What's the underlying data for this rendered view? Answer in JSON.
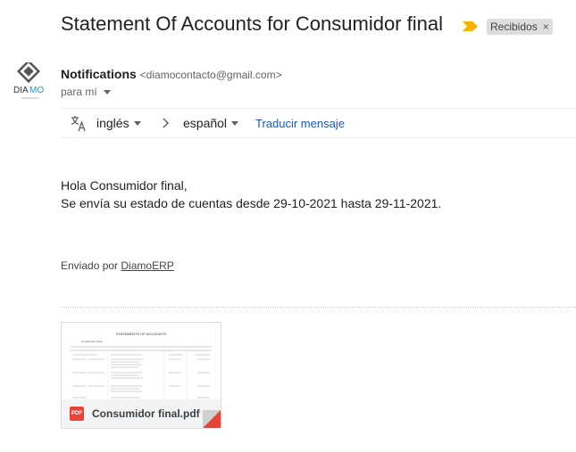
{
  "subject": "Statement Of Accounts for Consumidor final",
  "label": "Recibidos",
  "label_close": "×",
  "avatar": {
    "logo_text_a": "DIA",
    "logo_text_b": "MO"
  },
  "sender": {
    "name": "Notifications",
    "email": "<diamocontacto@gmail.com>"
  },
  "to": "para mí",
  "translate": {
    "source_lang": "inglés",
    "target_lang": "español",
    "link": "Traducir mensaje"
  },
  "message": {
    "greeting": "Hola Consumidor final,",
    "line": "Se envía su estado de cuentas desde 29-10-2021 hasta 29-11-2021."
  },
  "sent_by": {
    "prefix": "Enviado por",
    "link": "DiamoERP"
  },
  "attachment": {
    "filename": "Consumidor final.pdf",
    "type_label": "PDF",
    "preview_title": "STATEMENTS OF ACCOUNTS",
    "preview_customer": "Consumidor Final"
  },
  "colors": {
    "link": "#1a56c9",
    "label_bg": "#dddddd",
    "marker": "#f4b400",
    "pdf": "#ea4335"
  }
}
